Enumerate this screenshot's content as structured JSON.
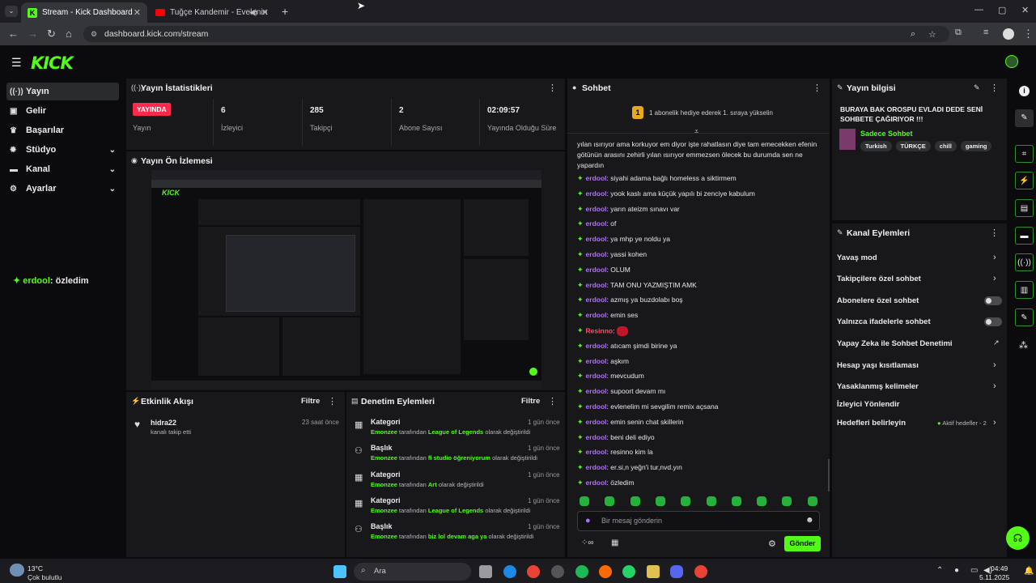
{
  "browser": {
    "tabs": [
      {
        "title": "Stream - Kick Dashboard"
      },
      {
        "title": "Tuğçe Kandemir - Evelenin"
      }
    ],
    "url": "dashboard.kick.com/stream"
  },
  "brand": {
    "logo": "KICK",
    "accent": "#53fc18"
  },
  "sidebar": {
    "items": [
      {
        "label": "Yayın",
        "icon": "broadcast-icon"
      },
      {
        "label": "Gelir",
        "icon": "money-icon"
      },
      {
        "label": "Başarılar",
        "icon": "trophy-icon"
      },
      {
        "label": "Stüdyo",
        "icon": "gear-icon"
      },
      {
        "label": "Kanal",
        "icon": "channel-icon"
      },
      {
        "label": "Ayarlar",
        "icon": "settings-icon"
      }
    ],
    "overlay_user": "erdool",
    "overlay_msg": ": özledim"
  },
  "stats": {
    "title": "Yayın İstatistikleri",
    "live_badge": "YAYINDA",
    "live_label": "Yayın",
    "items": [
      {
        "value": "6",
        "label": "İzleyici"
      },
      {
        "value": "285",
        "label": "Takipçi"
      },
      {
        "value": "2",
        "label": "Abone Sayısı"
      },
      {
        "value": "02:09:57",
        "label": "Yayında Olduğu Süre"
      }
    ]
  },
  "preview": {
    "title": "Yayın Ön İzlemesi"
  },
  "activity": {
    "title": "Etkinlik Akışı",
    "filter": "Filtre",
    "user": "hidra22",
    "text": "kanalı takip etti",
    "time": "23 saat önce"
  },
  "mod": {
    "title": "Denetim Eylemleri",
    "filter": "Filtre",
    "rows": [
      {
        "type": "Kategori",
        "who": "Emonzee",
        "mid": " tarafından ",
        "what": "League of Legends",
        "tail": " olarak değiştirildi",
        "time": "1 gün önce"
      },
      {
        "type": "Başlık",
        "who": "Emonzee",
        "mid": " tarafından ",
        "what": "fl studio öğreniyorum",
        "tail": " olarak değiştirildi",
        "time": "1 gün önce"
      },
      {
        "type": "Kategori",
        "who": "Emonzee",
        "mid": " tarafından ",
        "what": "Art",
        "tail": " olarak değiştirildi",
        "time": "1 gün önce"
      },
      {
        "type": "Kategori",
        "who": "Emonzee",
        "mid": " tarafından ",
        "what": "League of Legends",
        "tail": " olarak değiştirildi",
        "time": "1 gün önce"
      },
      {
        "type": "Başlık",
        "who": "Emonzee",
        "mid": " tarafından ",
        "what": "biz lol devam aga ya",
        "tail": " olarak değiştirildi",
        "time": "1 gün önce"
      }
    ]
  },
  "chat": {
    "title": "Sohbet",
    "pinned": "1 abonelik hediye ederek 1. sıraya yükselin",
    "intro": [
      "yılan ısırıyor ama korkuyor em diyor işte rahatlasın diye tam emecekken efenin",
      "götünün arasını zehirli yılan ısırıyor emmezsen ölecek bu durumda sen ne",
      "yapardın"
    ],
    "messages": [
      {
        "user": "erdool",
        "text": ": siyahi adama bağlı homeless a siktirmem"
      },
      {
        "user": "erdool",
        "text": ": yook kaslı ama küçük yapılı bi zenciye kabulum"
      },
      {
        "user": "erdool",
        "text": ": yarın ateizm sınavı var"
      },
      {
        "user": "erdool",
        "text": ": of"
      },
      {
        "user": "erdool",
        "text": ": ya mhp ye noldu ya"
      },
      {
        "user": "erdool",
        "text": ": yassi kohen"
      },
      {
        "user": "erdool",
        "text": ": OLUM"
      },
      {
        "user": "erdool",
        "text": ": TAM ONU YAZMIŞTIM AMK"
      },
      {
        "user": "erdool",
        "text": ": azmış ya buzdolabı boş"
      },
      {
        "user": "erdool",
        "text": ": emin ses"
      },
      {
        "user": "Resinno",
        "text": ":"
      },
      {
        "user": "erdool",
        "text": ": atıcam şimdi birine ya"
      },
      {
        "user": "erdool",
        "text": ": aşkım"
      },
      {
        "user": "erdool",
        "text": ": mevcudum"
      },
      {
        "user": "erdool",
        "text": ": supoort devam mı"
      },
      {
        "user": "erdool",
        "text": ": evlenelim mi sevgilim remix açsana"
      },
      {
        "user": "erdool",
        "text": ": emin senin chat skillerin"
      },
      {
        "user": "erdool",
        "text": ": beni deli ediyo"
      },
      {
        "user": "erdool",
        "text": ": resinno kim la"
      },
      {
        "user": "erdool",
        "text": ": er.si,n yeğn'i tur,nvd.yın"
      },
      {
        "user": "erdool",
        "text": ": özledim"
      }
    ],
    "placeholder": "Bir mesaj gönderin",
    "send": "Gönder"
  },
  "info": {
    "title": "Yayın bilgisi",
    "stream_title": "BURAYA BAK OROSPU EVLADI DEDE SENİ SOHBETE ÇAĞIRIYOR !!!",
    "mode": "Sadece Sohbet",
    "tags": [
      "Turkish",
      "TÜRKÇE",
      "chill",
      "gaming"
    ]
  },
  "actions": {
    "title": "Kanal Eylemleri",
    "items": [
      {
        "label": "Yavaş mod"
      },
      {
        "label": "Takipçilere özel sohbet"
      },
      {
        "label": "Abonelere özel sohbet"
      },
      {
        "label": "Yalnızca ifadelerle sohbet"
      },
      {
        "label": "Yapay Zeka ile Sohbet Denetimi"
      },
      {
        "label": "Hesap yaşı kısıtlaması"
      },
      {
        "label": "Yasaklanmış kelimeler"
      },
      {
        "label": "İzleyici Yönlendir"
      },
      {
        "label": "Hedefleri belirleyin"
      }
    ],
    "goals_status": "Aktif hedefler - 2"
  },
  "taskbar": {
    "weather_temp": "13°C",
    "weather_text": "Çok bulutlu",
    "search": "Ara",
    "time": "04:49",
    "date": "5.11.2025"
  }
}
